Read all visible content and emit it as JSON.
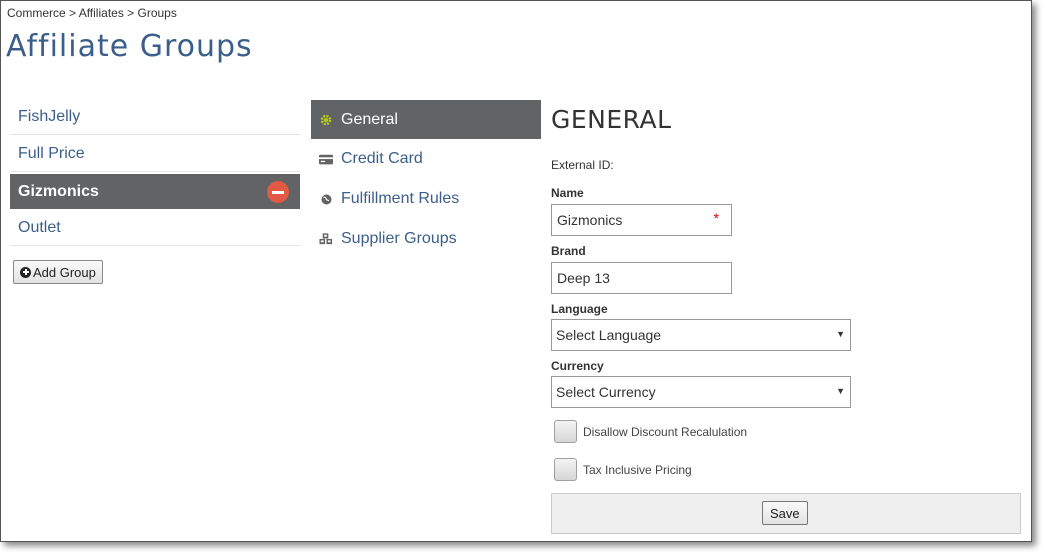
{
  "breadcrumb": "Commerce > Affiliates > Groups",
  "page_title": "Affiliate Groups",
  "groups": [
    {
      "label": "FishJelly"
    },
    {
      "label": "Full Price"
    },
    {
      "label": "Gizmonics"
    },
    {
      "label": "Outlet"
    }
  ],
  "add_group_label": "Add Group",
  "tabs": [
    {
      "label": "General",
      "icon": "gear-icon"
    },
    {
      "label": "Credit Card",
      "icon": "credit-card-icon"
    },
    {
      "label": "Fulfillment Rules",
      "icon": "globe-icon"
    },
    {
      "label": "Supplier Groups",
      "icon": "cubes-icon"
    }
  ],
  "form": {
    "section_title": "GENERAL",
    "external_id_label": "External ID:",
    "name_label": "Name",
    "name_value": "Gizmonics",
    "required_mark": "*",
    "brand_label": "Brand",
    "brand_value": "Deep 13",
    "language_label": "Language",
    "language_value": "Select Language",
    "currency_label": "Currency",
    "currency_value": "Select Currency",
    "disallow_discount_label": "Disallow Discount Recalulation",
    "tax_inclusive_label": "Tax Inclusive Pricing",
    "save_label": "Save"
  },
  "colors": {
    "accent": "#3b5f8a",
    "active_bg": "#626365",
    "remove": "#e05a45",
    "gear": "#b5cc18"
  }
}
